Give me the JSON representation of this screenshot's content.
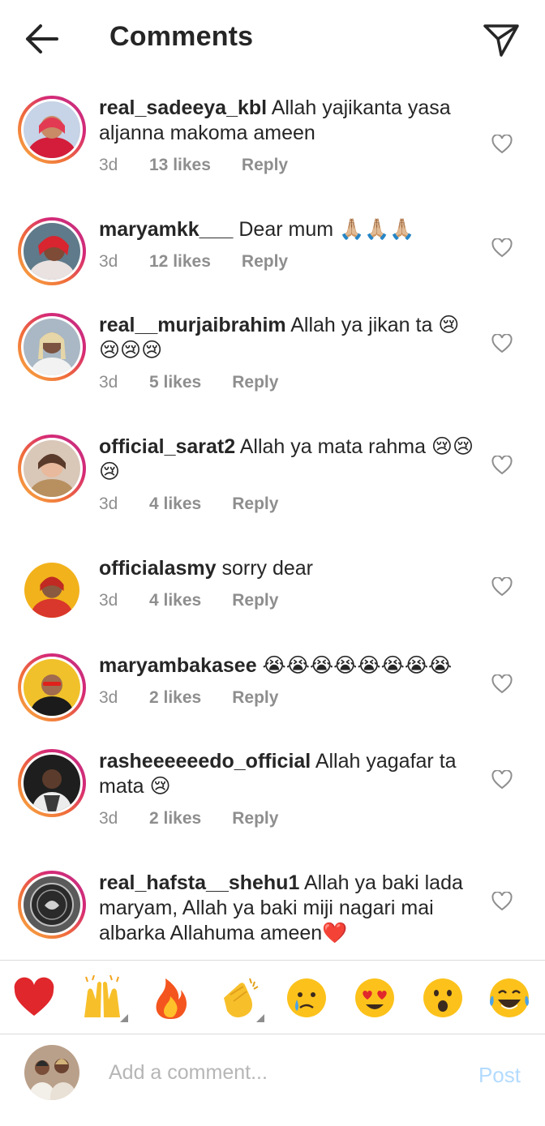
{
  "header": {
    "title": "Comments",
    "back_icon": "arrow-left-icon",
    "share_icon": "paper-plane-icon"
  },
  "comments": [
    {
      "username": "real_sadeeya_kbl",
      "text": "Allah yajikanta yasa aljanna makoma ameen",
      "time": "3d",
      "likes": "13 likes",
      "reply": "Reply"
    },
    {
      "username": "maryamkk___",
      "text": "Dear mum 🙏🏼🙏🏼🙏🏼",
      "time": "3d",
      "likes": "12 likes",
      "reply": "Reply"
    },
    {
      "username": "real__murjaibrahim",
      "text": "Allah ya jikan ta 😢😢😢😢",
      "time": "3d",
      "likes": "5 likes",
      "reply": "Reply"
    },
    {
      "username": "official_sarat2",
      "text": "Allah ya mata rahma 😢😢😢",
      "time": "3d",
      "likes": "4 likes",
      "reply": "Reply"
    },
    {
      "username": "officialasmy",
      "text": "sorry dear",
      "time": "3d",
      "likes": "4 likes",
      "reply": "Reply"
    },
    {
      "username": "maryambakasee",
      "text": "😭😭😭😭😭😭😭😭",
      "time": "3d",
      "likes": "2 likes",
      "reply": "Reply"
    },
    {
      "username": "rasheeeeeedo_official",
      "text": "Allah yagafar ta mata 😢",
      "time": "3d",
      "likes": "2 likes",
      "reply": "Reply"
    },
    {
      "username": "real_hafsta__shehu1",
      "text": "Allah ya baki lada maryam, Allah ya baki miji nagari mai albarka Allahuma ameen❤️",
      "time": "",
      "likes": "",
      "reply": ""
    }
  ],
  "reactions": [
    "heart-emoji",
    "raised-hands-emoji",
    "fire-emoji",
    "clapping-hands-emoji",
    "crying-face-emoji",
    "heart-eyes-emoji",
    "surprised-face-emoji",
    "tears-of-joy-emoji"
  ],
  "composer": {
    "placeholder": "Add a comment...",
    "post_label": "Post"
  },
  "colors": {
    "text": "#262626",
    "meta": "#8e8e8e",
    "post_disabled": "#b3dbff",
    "story_ring_start": "#f9b042",
    "story_ring_end": "#c13584"
  }
}
